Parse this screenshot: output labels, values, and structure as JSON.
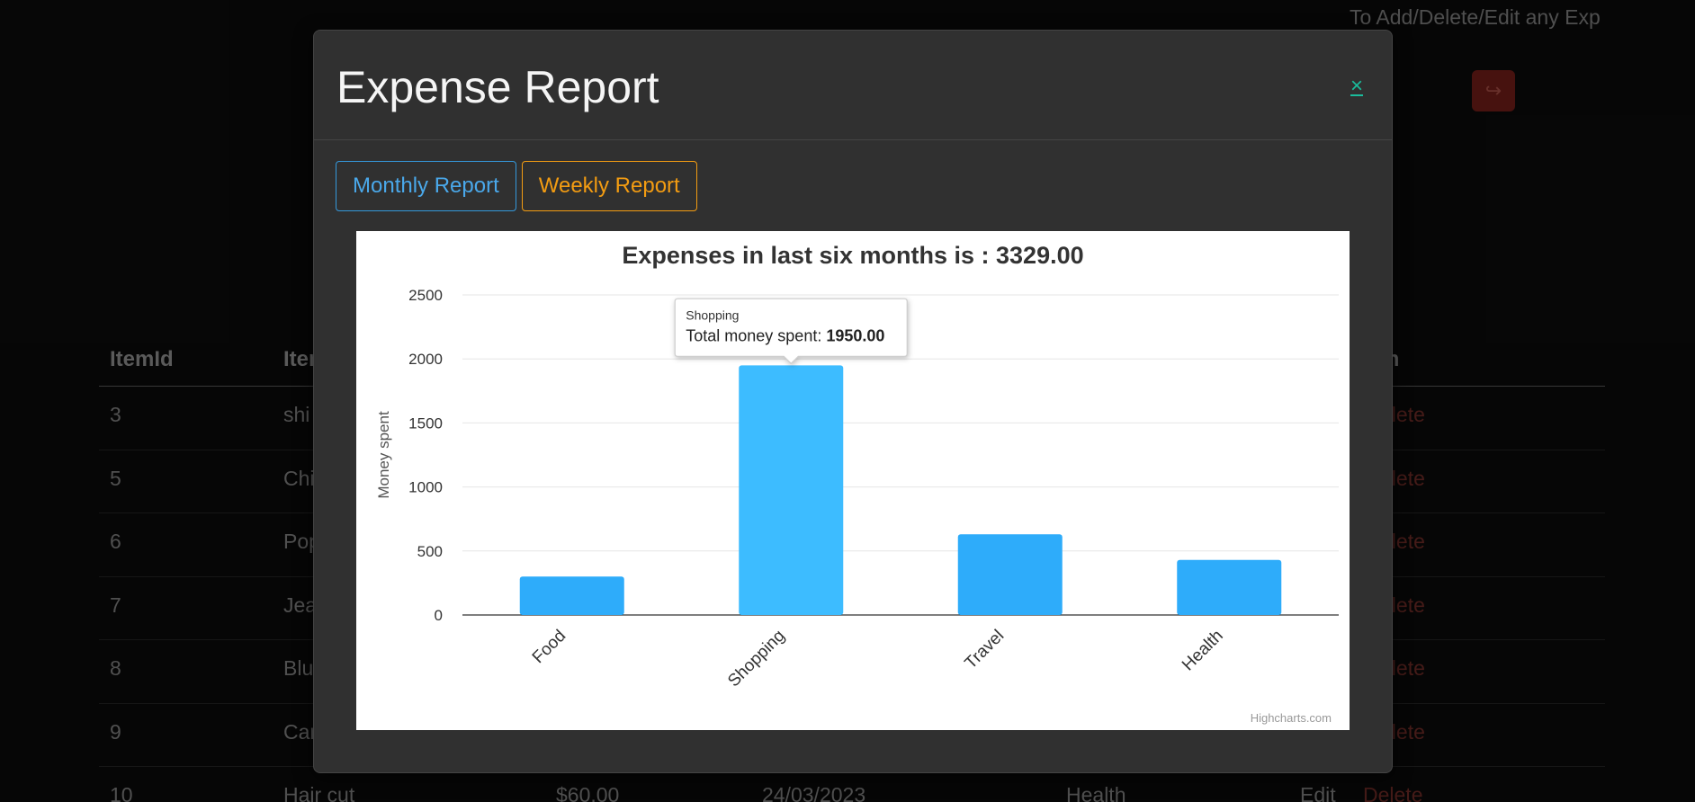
{
  "page": {
    "hint_text": "To Add/Delete/Edit any Exp",
    "logout_icon": "sign-out-icon"
  },
  "table": {
    "headers": {
      "id": "ItemId",
      "name": "Item",
      "last": "m"
    },
    "rows": [
      {
        "id": "3",
        "name": "shi",
        "amount": "",
        "date": "",
        "category": "",
        "edit": "",
        "delete": "elete"
      },
      {
        "id": "5",
        "name": "Chi",
        "amount": "",
        "date": "",
        "category": "",
        "edit": "",
        "delete": "elete"
      },
      {
        "id": "6",
        "name": "Pop",
        "amount": "",
        "date": "",
        "category": "",
        "edit": "",
        "delete": "elete"
      },
      {
        "id": "7",
        "name": "Jea",
        "amount": "",
        "date": "",
        "category": "",
        "edit": "",
        "delete": "elete"
      },
      {
        "id": "8",
        "name": "Blu",
        "amount": "",
        "date": "",
        "category": "",
        "edit": "",
        "delete": "elete"
      },
      {
        "id": "9",
        "name": "Car",
        "amount": "",
        "date": "",
        "category": "",
        "edit": "",
        "delete": "elete"
      },
      {
        "id": "10",
        "name": "Hair cut",
        "amount": "$60.00",
        "date": "24/03/2023",
        "category": "Health",
        "edit": "Edit",
        "delete": "Delete"
      }
    ]
  },
  "modal": {
    "title": "Expense Report",
    "close_label": "×",
    "tabs": [
      {
        "label": "Monthly Report"
      },
      {
        "label": "Weekly Report"
      }
    ],
    "credits": "Highcharts.com"
  },
  "chart_data": {
    "type": "bar",
    "title": "Expenses in last six months is : 3329.00",
    "ylabel": "Money spent",
    "xlabel": "",
    "categories": [
      "Food",
      "Shopping",
      "Travel",
      "Health"
    ],
    "values": [
      300,
      1950,
      630,
      430
    ],
    "ylim": [
      0,
      2500
    ],
    "yticks": [
      0,
      500,
      1000,
      1500,
      2000,
      2500
    ],
    "grid": true,
    "bar_color": "#2eacfa",
    "hover_color": "#3dbcff",
    "tooltip": {
      "category": "Shopping",
      "label": "Total money spent: ",
      "value": "1950.00"
    }
  }
}
